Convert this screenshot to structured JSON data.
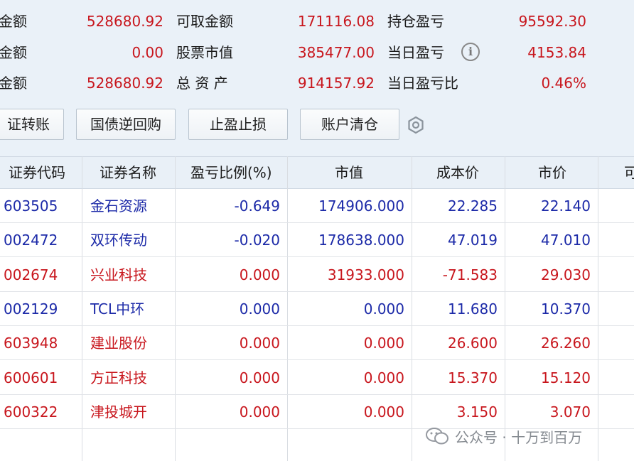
{
  "summary": {
    "row1": {
      "label_a": "金额",
      "value_a": "528680.92",
      "label_b": "可取金额",
      "value_b": "171116.08",
      "label_c": "持仓盈亏",
      "value_c": "95592.30"
    },
    "row2": {
      "label_a": "金额",
      "value_a": "0.00",
      "label_b": "股票市值",
      "value_b": "385477.00",
      "label_c": "当日盈亏",
      "value_c": "4153.84"
    },
    "row3": {
      "label_a": "金额",
      "value_a": "528680.92",
      "label_b": "总 资 产",
      "value_b": "914157.92",
      "label_c": "当日盈亏比",
      "value_c": "0.46%"
    },
    "info_glyph": "i"
  },
  "toolbar": {
    "transfer_label": "证转账",
    "repo_label": "国债逆回购",
    "stop_label": "止盈止损",
    "clear_label": "账户清仓"
  },
  "table": {
    "headers": [
      "证券代码",
      "证券名称",
      "盈亏比例(%)",
      "市值",
      "成本价",
      "市价",
      "可"
    ],
    "rows": [
      {
        "code": "603505",
        "name": "金石资源",
        "pct": "-0.649",
        "mv": "174906.000",
        "cost": "22.285",
        "price": "22.140",
        "color": "blue"
      },
      {
        "code": "002472",
        "name": "双环传动",
        "pct": "-0.020",
        "mv": "178638.000",
        "cost": "47.019",
        "price": "47.010",
        "color": "blue"
      },
      {
        "code": "002674",
        "name": "兴业科技",
        "pct": "0.000",
        "mv": "31933.000",
        "cost": "-71.583",
        "price": "29.030",
        "color": "red"
      },
      {
        "code": "002129",
        "name": "TCL中环",
        "pct": "0.000",
        "mv": "0.000",
        "cost": "11.680",
        "price": "10.370",
        "color": "blue"
      },
      {
        "code": "603948",
        "name": "建业股份",
        "pct": "0.000",
        "mv": "0.000",
        "cost": "26.600",
        "price": "26.260",
        "color": "red"
      },
      {
        "code": "600601",
        "name": "方正科技",
        "pct": "0.000",
        "mv": "0.000",
        "cost": "15.370",
        "price": "15.120",
        "color": "red"
      },
      {
        "code": "600322",
        "name": "津投城开",
        "pct": "0.000",
        "mv": "0.000",
        "cost": "3.150",
        "price": "3.070",
        "color": "red"
      }
    ]
  },
  "watermark": {
    "text": "公众号 · 十万到百万"
  },
  "colors": {
    "up_red": "#c8161d",
    "down_blue": "#1c2aa8",
    "panel_bg": "#eaf1f8"
  }
}
